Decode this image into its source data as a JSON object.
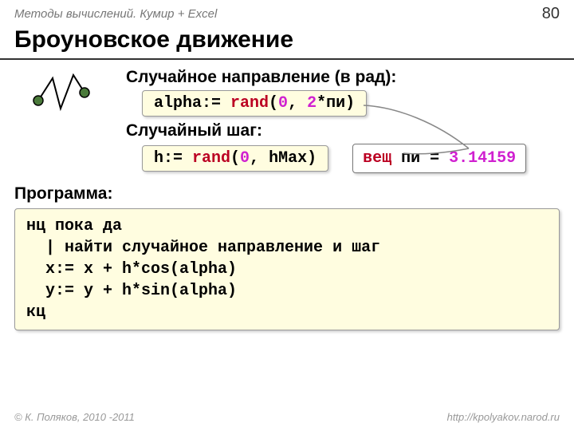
{
  "header": {
    "course": "Методы вычислений. Кумир + Excel",
    "page": "80"
  },
  "title": "Броуновское движение",
  "sec1": {
    "label": "Случайное направление (в рад):",
    "code_pre": "alpha:= ",
    "code_fn": "rand",
    "code_open": "(",
    "code_arg1": "0",
    "code_comma": ", ",
    "code_arg2": "2",
    "code_mul": "*пи)"
  },
  "sec2": {
    "label": "Случайный шаг:",
    "code_pre": "h:= ",
    "code_fn": "rand",
    "code_open": "(",
    "code_arg1": "0",
    "code_comma": ", hMax)"
  },
  "tooltip": {
    "kw": "вещ",
    "text": " пи = ",
    "val": "3.14159"
  },
  "program": {
    "label": "Программа:",
    "l1a": "нц пока да",
    "l2a": "  | найти случайное направление и шаг",
    "l3": "  x:= x + h*cos(alpha)",
    "l4": "  y:= y + h*sin(alpha)",
    "l5": "кц"
  },
  "footer": {
    "left": "© К. Поляков, 2010 -2011",
    "right": "http://kpolyakov.narod.ru"
  }
}
